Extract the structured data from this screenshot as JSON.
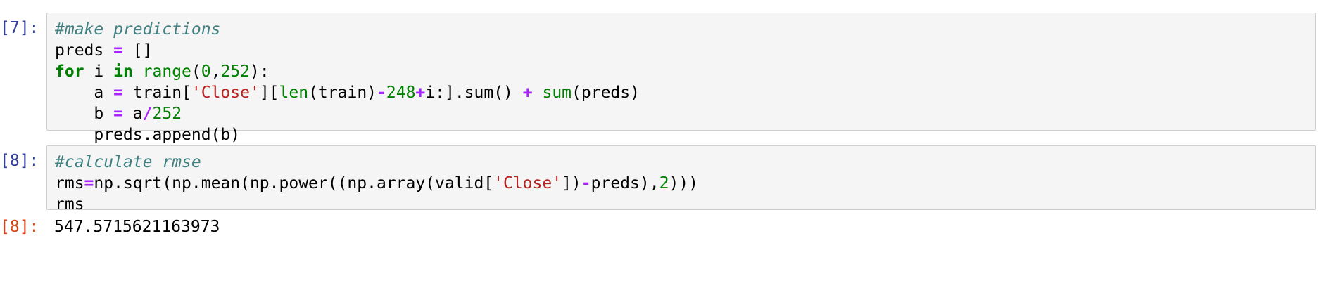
{
  "cells": [
    {
      "prompt": "[7]:",
      "lines": [
        [
          {
            "t": "#make predictions",
            "c": "comment"
          }
        ],
        [
          {
            "t": "preds ",
            "c": ""
          },
          {
            "t": "=",
            "c": "op"
          },
          {
            "t": " []",
            "c": ""
          }
        ],
        [
          {
            "t": "for",
            "c": "kw"
          },
          {
            "t": " i ",
            "c": ""
          },
          {
            "t": "in",
            "c": "kw"
          },
          {
            "t": " ",
            "c": ""
          },
          {
            "t": "range",
            "c": "builtin"
          },
          {
            "t": "(",
            "c": ""
          },
          {
            "t": "0",
            "c": "num"
          },
          {
            "t": ",",
            "c": ""
          },
          {
            "t": "252",
            "c": "num"
          },
          {
            "t": "):",
            "c": ""
          }
        ],
        [
          {
            "t": "    a ",
            "c": ""
          },
          {
            "t": "=",
            "c": "op"
          },
          {
            "t": " train[",
            "c": ""
          },
          {
            "t": "'Close'",
            "c": "str"
          },
          {
            "t": "][",
            "c": ""
          },
          {
            "t": "len",
            "c": "builtin"
          },
          {
            "t": "(train)",
            "c": ""
          },
          {
            "t": "-",
            "c": "op"
          },
          {
            "t": "248",
            "c": "num"
          },
          {
            "t": "+",
            "c": "op"
          },
          {
            "t": "i:].sum() ",
            "c": ""
          },
          {
            "t": "+",
            "c": "op"
          },
          {
            "t": " ",
            "c": ""
          },
          {
            "t": "sum",
            "c": "builtin"
          },
          {
            "t": "(preds)",
            "c": ""
          }
        ],
        [
          {
            "t": "    b ",
            "c": ""
          },
          {
            "t": "=",
            "c": "op"
          },
          {
            "t": " a",
            "c": ""
          },
          {
            "t": "/",
            "c": "op"
          },
          {
            "t": "252",
            "c": "num"
          }
        ],
        [
          {
            "t": "    preds.append(b)",
            "c": ""
          }
        ]
      ]
    },
    {
      "prompt": "[8]:",
      "lines": [
        [
          {
            "t": "#calculate rmse",
            "c": "comment"
          }
        ],
        [
          {
            "t": "rms",
            "c": ""
          },
          {
            "t": "=",
            "c": "op"
          },
          {
            "t": "np.sqrt(np.mean(np.power((np.array(valid[",
            "c": ""
          },
          {
            "t": "'Close'",
            "c": "str"
          },
          {
            "t": "])",
            "c": ""
          },
          {
            "t": "-",
            "c": "op"
          },
          {
            "t": "preds),",
            "c": ""
          },
          {
            "t": "2",
            "c": "num"
          },
          {
            "t": ")))",
            "c": ""
          }
        ],
        [
          {
            "t": "rms",
            "c": ""
          }
        ]
      ]
    }
  ],
  "output": {
    "prompt": "[8]:",
    "value": "547.5715621163973"
  },
  "colors": {
    "in_prompt": "#303f9f",
    "out_prompt": "#d84315",
    "keyword": "#008000",
    "operator": "#aa22ff",
    "string": "#ba2121",
    "comment": "#408080",
    "cell_background": "#f5f5f5",
    "cell_border": "#cfcfcf"
  }
}
